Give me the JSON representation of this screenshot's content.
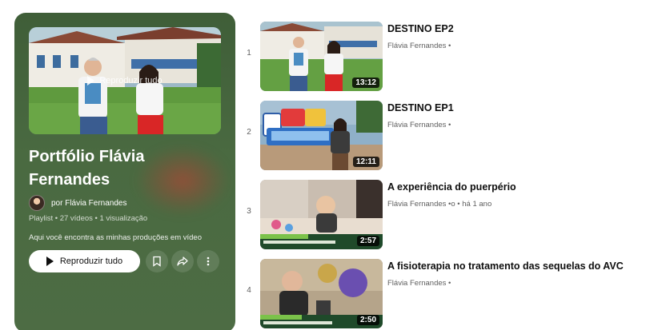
{
  "playlist": {
    "title": "Portfólio Flávia Fernandes",
    "cover_overlay": "Reproduzir tudo",
    "owner_label": "por Flávia Fernandes",
    "meta": "Playlist • 27 vídeos • 1 visualização",
    "description": "Aqui você encontra as minhas produções em vídeo",
    "play_all_label": "Reproduzir tudo",
    "icons": [
      "bookmark-icon",
      "share-icon",
      "more-vert-icon"
    ],
    "colors": {
      "panel": "#4a6a41",
      "button": "#ffffff"
    }
  },
  "videos": [
    {
      "index": "1",
      "title": "DESTINO EP2",
      "channel": "Flávia Fernandes",
      "extra": "•",
      "duration": "13:12"
    },
    {
      "index": "2",
      "title": "DESTINO EP1",
      "channel": "Flávia Fernandes",
      "extra": "•",
      "duration": "12:11"
    },
    {
      "index": "3",
      "title": "A experiência do puerpério",
      "channel": "Flávia Fernandes",
      "extra": "•o • há 1 ano",
      "duration": "2:57"
    },
    {
      "index": "4",
      "title": "A fisioterapia no tratamento das sequelas do AVC",
      "channel": "Flávia Fernandes",
      "extra": "•",
      "duration": "2:50"
    }
  ]
}
